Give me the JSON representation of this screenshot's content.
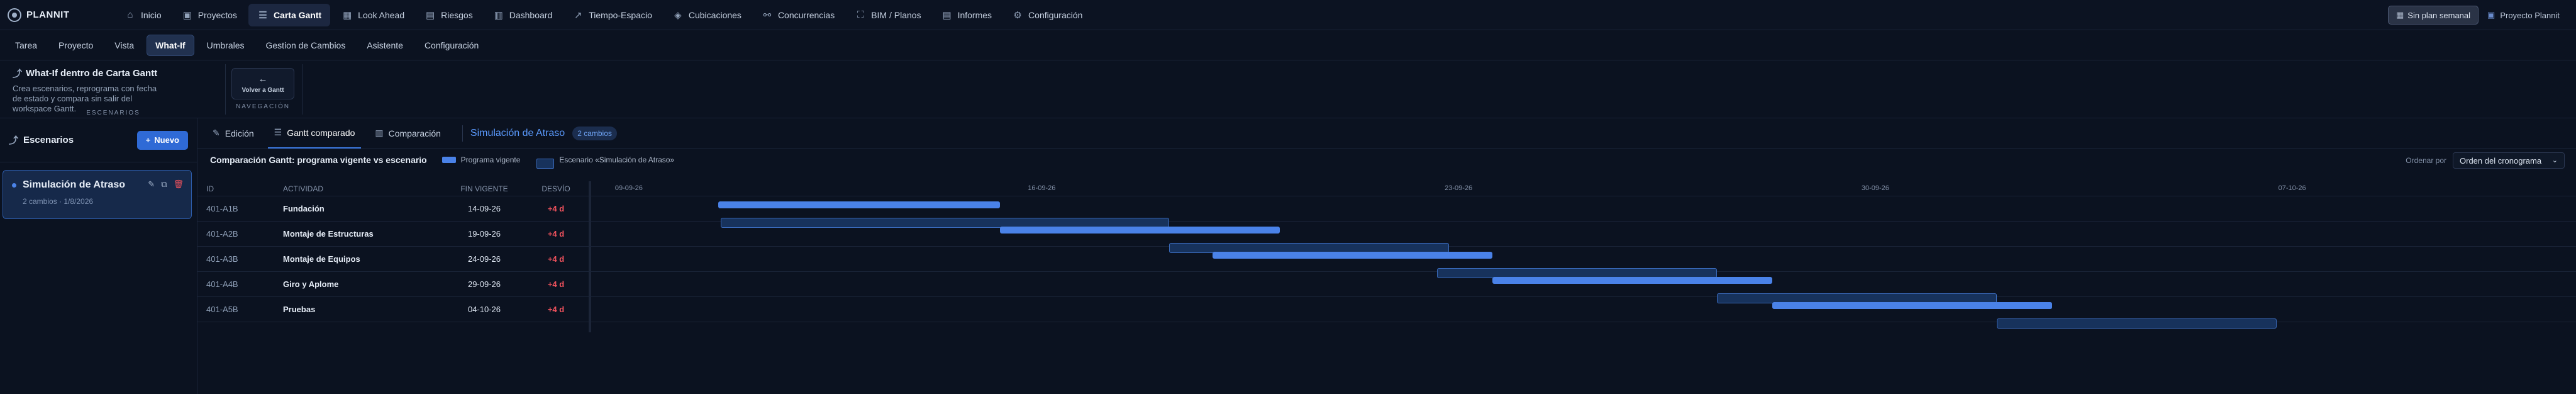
{
  "brand": "PLANNIT",
  "topnav": [
    {
      "label": "Inicio",
      "icon": "home-icon",
      "glyph": "⌂"
    },
    {
      "label": "Proyectos",
      "icon": "briefcase-icon",
      "glyph": "▣"
    },
    {
      "label": "Carta Gantt",
      "icon": "gantt-icon",
      "glyph": "☰",
      "active": true
    },
    {
      "label": "Look Ahead",
      "icon": "calendar-icon",
      "glyph": "▦"
    },
    {
      "label": "Riesgos",
      "icon": "warning-icon",
      "glyph": "▤"
    },
    {
      "label": "Dashboard",
      "icon": "chart-icon",
      "glyph": "▥"
    },
    {
      "label": "Tiempo-Espacio",
      "icon": "trend-icon",
      "glyph": "↗"
    },
    {
      "label": "Cubicaciones",
      "icon": "cube-icon",
      "glyph": "◈"
    },
    {
      "label": "Concurrencias",
      "icon": "link-icon",
      "glyph": "⚯"
    },
    {
      "label": "BIM / Planos",
      "icon": "bim-icon",
      "glyph": "⛶"
    },
    {
      "label": "Informes",
      "icon": "document-icon",
      "glyph": "▤"
    },
    {
      "label": "Configuración",
      "icon": "gear-icon",
      "glyph": "⚙"
    }
  ],
  "topright": {
    "plan_label": "Sin plan semanal",
    "project_label": "Proyecto Plannit"
  },
  "subnav": [
    {
      "label": "Tarea"
    },
    {
      "label": "Proyecto"
    },
    {
      "label": "Vista"
    },
    {
      "label": "What-If",
      "active": true
    },
    {
      "label": "Umbrales"
    },
    {
      "label": "Gestion de Cambios"
    },
    {
      "label": "Asistente"
    },
    {
      "label": "Configuración"
    }
  ],
  "ribbon": {
    "title": "What-If dentro de Carta Gantt",
    "description": "Crea escenarios, reprograma con fecha de estado y compara sin salir del workspace Gantt.",
    "group_label": "ESCENARIOS",
    "back_button": "Volver a Gantt",
    "nav_label": "NAVEGACIÓN"
  },
  "sidebar": {
    "title": "Escenarios",
    "new_button": "Nuevo",
    "scenario": {
      "name": "Simulación de Atraso",
      "meta": "2 cambios · 1/8/2026"
    }
  },
  "tabs": [
    {
      "label": "Edición",
      "icon": "edit-icon",
      "glyph": "✎"
    },
    {
      "label": "Gantt comparado",
      "icon": "gantt-icon",
      "glyph": "☰",
      "active": true
    },
    {
      "label": "Comparación",
      "icon": "chart-icon",
      "glyph": "▥"
    }
  ],
  "simulation": {
    "title": "Simulación de Atraso",
    "badge": "2 cambios"
  },
  "comparison": {
    "title": "Comparación Gantt: programa vigente vs escenario",
    "legend_base": "Programa vigente",
    "legend_scen": "Escenario «Simulación de Atraso»",
    "order_label": "Ordenar por",
    "order_value": "Orden del cronograma"
  },
  "table": {
    "headers": {
      "id": "ID",
      "activity": "ACTIVIDAD",
      "end": "FIN VIGENTE",
      "dev": "DESVÍO"
    },
    "rows": [
      {
        "id": "401-A1B",
        "activity": "Fundación",
        "end": "14-09-26",
        "dev": "+4 d"
      },
      {
        "id": "401-A2B",
        "activity": "Montaje de Estructuras",
        "end": "19-09-26",
        "dev": "+4 d"
      },
      {
        "id": "401-A3B",
        "activity": "Montaje de Equipos",
        "end": "24-09-26",
        "dev": "+4 d"
      },
      {
        "id": "401-A4B",
        "activity": "Giro y Aplome",
        "end": "29-09-26",
        "dev": "+4 d"
      },
      {
        "id": "401-A5B",
        "activity": "Pruebas",
        "end": "04-10-26",
        "dev": "+4 d"
      }
    ]
  },
  "timeline": {
    "dates": [
      "09-09-26",
      "16-09-26",
      "23-09-26",
      "30-09-26",
      "07-10-26"
    ],
    "bars": [
      {
        "base_start": 0.064,
        "base_end": 0.206,
        "scen_start": 0.064,
        "scen_end": 0.29
      },
      {
        "base_start": 0.206,
        "base_end": 0.347,
        "scen_start": 0.29,
        "scen_end": 0.431
      },
      {
        "base_start": 0.313,
        "base_end": 0.454,
        "scen_start": 0.425,
        "scen_end": 0.566
      },
      {
        "base_start": 0.454,
        "base_end": 0.595,
        "scen_start": 0.566,
        "scen_end": 0.707
      },
      {
        "base_start": 0.595,
        "base_end": 0.736,
        "scen_start": 0.707,
        "scen_end": 0.848
      }
    ]
  }
}
